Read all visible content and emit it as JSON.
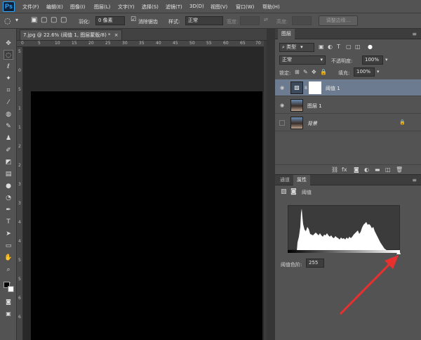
{
  "app": {
    "logo": "Ps"
  },
  "menu": [
    "文件(F)",
    "编辑(E)",
    "图像(I)",
    "图层(L)",
    "文字(Y)",
    "选择(S)",
    "滤镜(T)",
    "3D(D)",
    "视图(V)",
    "窗口(W)",
    "帮助(H)"
  ],
  "options": {
    "feather_label": "羽化:",
    "feather_value": "0 像素",
    "antialias_label": "消除锯齿",
    "style_label": "样式:",
    "style_value": "正常",
    "width_label": "宽度:",
    "height_label": "高度:",
    "refine_edge": "调整边缘..."
  },
  "document": {
    "tab_title": "7.jpg @ 22.6% (阈值 1, 图层蒙版/8) *",
    "close": "×"
  },
  "rulers": {
    "h_ticks": [
      "0",
      "5",
      "10",
      "15",
      "20",
      "25",
      "30",
      "35",
      "40",
      "45",
      "50",
      "55",
      "60",
      "65",
      "70"
    ],
    "v_ticks": [
      "5",
      "0",
      "5",
      "1",
      "1",
      "2",
      "2",
      "3",
      "3",
      "4",
      "4",
      "5",
      "5",
      "6",
      "6"
    ]
  },
  "layers_panel": {
    "tab": "图层",
    "kind_value": "类型",
    "blend_mode": "正常",
    "opacity_label": "不透明度:",
    "opacity_value": "100%",
    "lock_label": "锁定:",
    "fill_label": "填充:",
    "fill_value": "100%",
    "layers": [
      {
        "name": "阈值 1",
        "selected": true
      },
      {
        "name": "图层 1",
        "selected": false
      },
      {
        "name": "背景",
        "selected": false
      }
    ]
  },
  "properties_panel": {
    "tabs": [
      "通道",
      "属性"
    ],
    "title": "阈值",
    "threshold_label": "阈值色阶:",
    "threshold_value": "255"
  },
  "colors": {
    "accent_arrow": "#e8302f",
    "selected_layer": "#6c7b8f"
  }
}
